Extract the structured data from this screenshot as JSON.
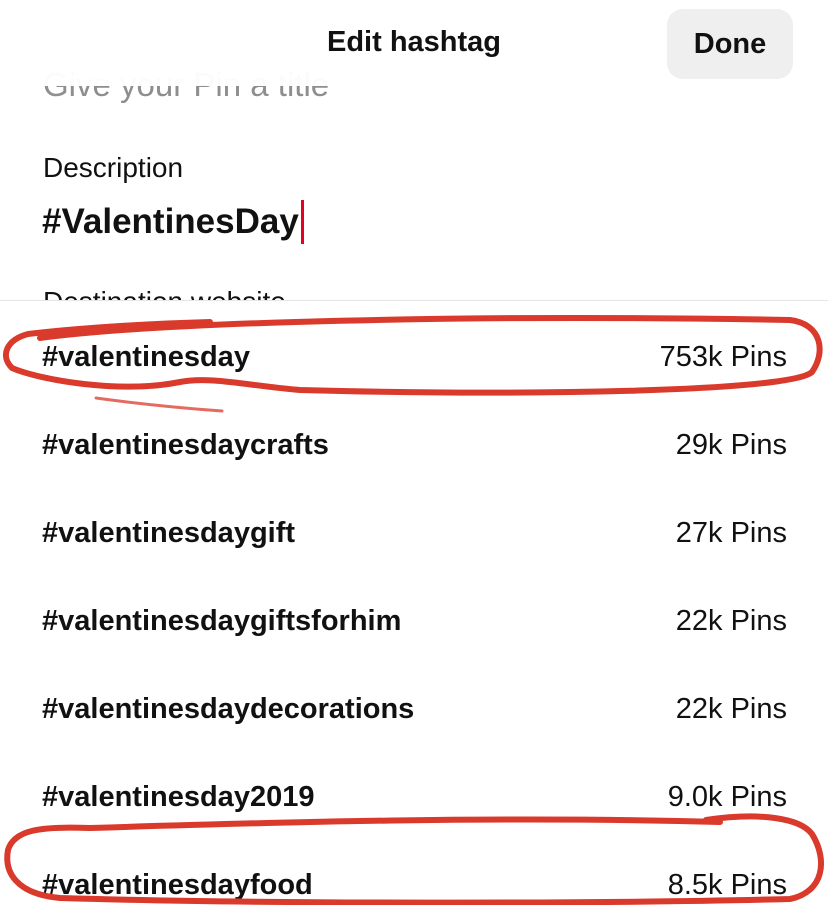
{
  "header": {
    "title": "Edit hashtag",
    "done_label": "Done"
  },
  "form": {
    "title_placeholder": "Give your Pin a title",
    "description_label": "Description",
    "description_value": "#ValentinesDay",
    "destination_label": "Destination website"
  },
  "suggestions": [
    {
      "tag": "#valentinesday",
      "count": "753k Pins"
    },
    {
      "tag": "#valentinesdaycrafts",
      "count": "29k Pins"
    },
    {
      "tag": "#valentinesdaygift",
      "count": "27k Pins"
    },
    {
      "tag": "#valentinesdaygiftsforhim",
      "count": "22k Pins"
    },
    {
      "tag": "#valentinesdaydecorations",
      "count": "22k Pins"
    },
    {
      "tag": "#valentinesday2019",
      "count": "9.0k Pins"
    },
    {
      "tag": "#valentinesdayfood",
      "count": "8.5k Pins"
    }
  ],
  "colors": {
    "caret": "#e60023",
    "annotation": "#d93a2b",
    "done_button_bg": "#efefef"
  }
}
